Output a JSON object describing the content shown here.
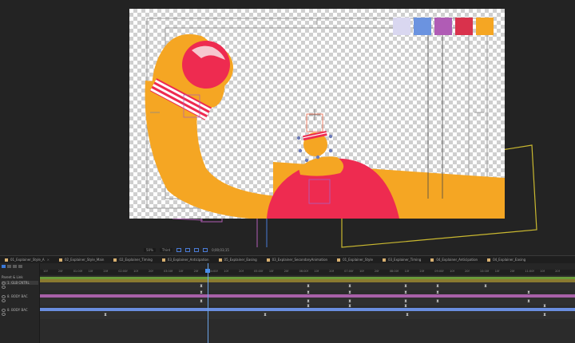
{
  "viewer": {
    "zoom_label": "50%",
    "resolution_label": "Third",
    "timecode": "0;00;03;15",
    "swatches": [
      "#d9d7f0",
      "#6b93e0",
      "#b05cb5",
      "#d9324c",
      "#f5a623"
    ],
    "colors": {
      "orange": "#f5a623",
      "red": "#ee2b50",
      "pale_pink": "#f6c8cf",
      "white": "#ffffff"
    }
  },
  "tabs": [
    {
      "label": "01_Explainer_Style_A"
    },
    {
      "label": "02_Explainer_Style_Main"
    },
    {
      "label": "02_Explainer_Timing"
    },
    {
      "label": "03_Explainer_Anticipation"
    },
    {
      "label": "05_Explainer_Easing"
    },
    {
      "label": "03_Explainer_SecondaryAnimation"
    },
    {
      "label": "01_Explainer_Style"
    },
    {
      "label": "03_Explainer_Timing"
    },
    {
      "label": "04_Explainer_Anticipation"
    },
    {
      "label": "04_Explainer_Easing"
    }
  ],
  "layers": {
    "header": "Parent & Link",
    "rows": [
      {
        "label": "1. GLB CNTRL",
        "selected": true
      },
      {
        "label": "8. BODY BAC"
      },
      {
        "label": "8. BODY BAC"
      }
    ]
  },
  "timeline": {
    "ruler_labels": [
      "10f",
      "20f",
      "01:00f",
      "10f",
      "20f",
      "02:00f",
      "10f",
      "20f",
      "03:00f",
      "10f",
      "20f",
      "04:00f",
      "10f",
      "20f",
      "05:00f",
      "10f",
      "20f",
      "06:00f",
      "10f",
      "20f",
      "07:00f",
      "10f",
      "20f",
      "08:00f",
      "10f",
      "20f",
      "09:00f",
      "10f",
      "20f",
      "10:00f",
      "10f",
      "20f",
      "11:00f",
      "10f",
      "20f"
    ],
    "track_colors": {
      "green": "#6a9a3a",
      "olive": "#8a7a30",
      "purple": "#a860a8",
      "blue": "#6a8ee0"
    },
    "keyframe_glyph": "⧗"
  }
}
